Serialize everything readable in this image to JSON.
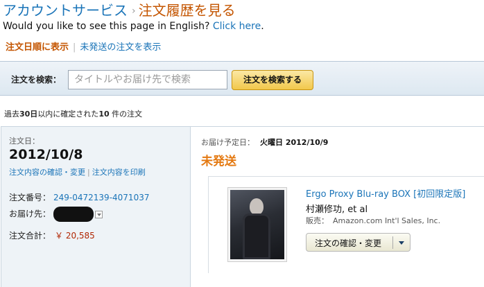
{
  "breadcrumb": {
    "parent": "アカウントサービス",
    "separator": "›",
    "current": "注文履歴を見る"
  },
  "english_prompt": {
    "text": "Would you like to see this page in English?",
    "link": "Click here",
    "suffix": "."
  },
  "sort": {
    "active": "注文日順に表示",
    "separator": "|",
    "other": "未発送の注文を表示"
  },
  "search": {
    "label": "注文を検索：",
    "placeholder": "タイトルやお届け先で検索",
    "button": "注文を検索する"
  },
  "summary": {
    "prefix": "過去",
    "days": "30日",
    "middle": "以内に確定された",
    "count": "10",
    "suffix": " 件の注文"
  },
  "order": {
    "date_label": "注文日：",
    "date": "2012/10/8",
    "details_link": "注文内容の確認・変更",
    "link_sep": "|",
    "print_link": "注文内容を印刷",
    "number_label": "注文番号：",
    "number": "249-0472139-4071037",
    "ship_to_label": "お届け先：",
    "total_label": "注文合計：",
    "total": "￥ 20,585",
    "delivery_label": "お届け予定日：",
    "delivery_date": "火曜日 2012/10/9",
    "status": "未発送",
    "item": {
      "title": "Ergo Proxy Blu-ray BOX [初回限定版]",
      "author": "村瀬修功, et al",
      "seller_label": "販売：",
      "seller": "Amazon.com Int'l Sales, Inc.",
      "button": "注文の確認・変更"
    }
  }
}
